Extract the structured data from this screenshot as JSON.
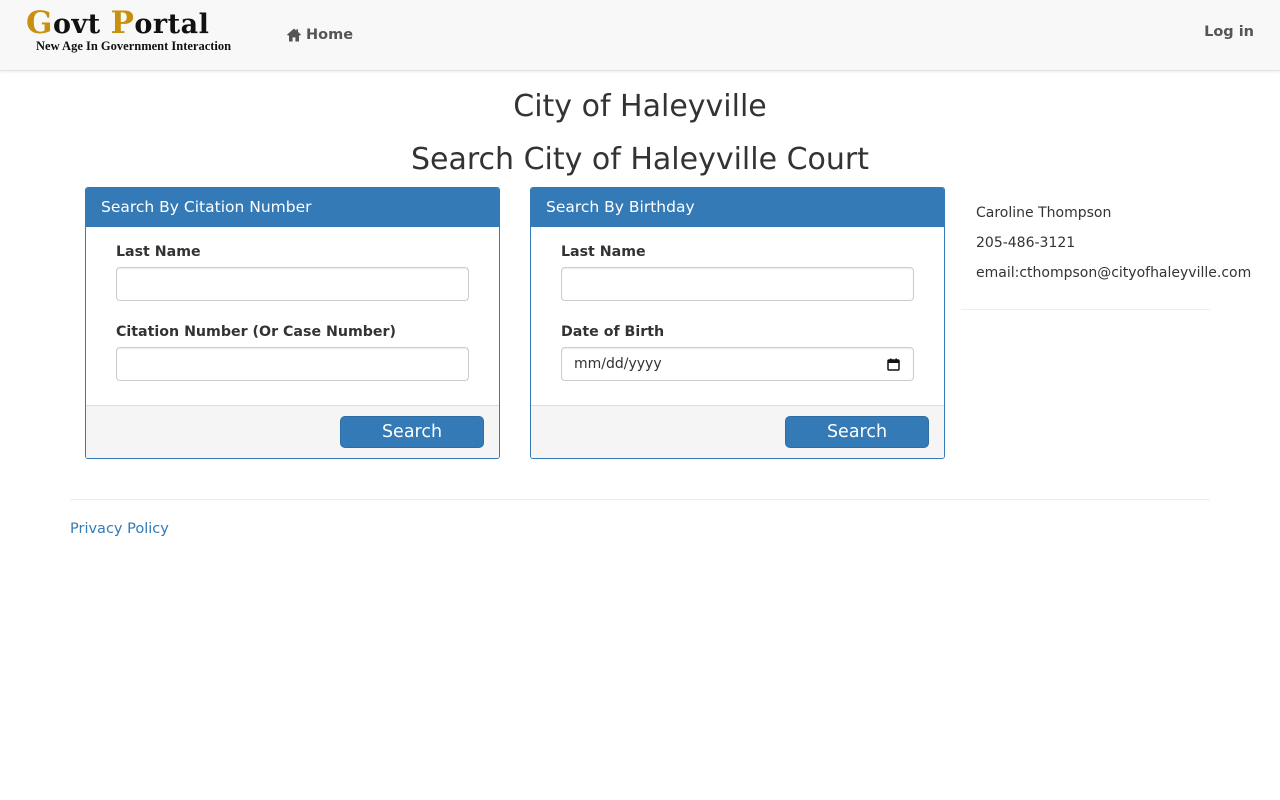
{
  "brand": {
    "title_first_letter": "G",
    "title_first_rest": "ovt ",
    "title_second_letter": "P",
    "title_second_rest": "ortal",
    "tagline": "New Age In Government Interaction"
  },
  "nav": {
    "home_label": "Home",
    "home_icon": "home-icon",
    "login_label": "Log in"
  },
  "page": {
    "title": "City of Haleyville",
    "subtitle": "Search City of Haleyville Court"
  },
  "citation_panel": {
    "heading": "Search By Citation Number",
    "last_name_label": "Last Name",
    "last_name_value": "",
    "citation_label": "Citation Number (Or Case Number)",
    "citation_value": "",
    "search_label": "Search"
  },
  "birthday_panel": {
    "heading": "Search By Birthday",
    "last_name_label": "Last Name",
    "last_name_value": "",
    "dob_label": "Date of Birth",
    "dob_placeholder": "mm/dd/yyyy",
    "dob_icon": "calendar-icon",
    "search_label": "Search"
  },
  "contact": {
    "name": "Caroline Thompson",
    "phone": "205-486-3121",
    "email": "email:cthompson@cityofhaleyville.com"
  },
  "footer": {
    "privacy_label": "Privacy Policy"
  },
  "colors": {
    "primary": "#337ab7",
    "brand_accent": "#c8900e",
    "navbar_bg": "#f8f8f8",
    "panel_footer_bg": "#f5f5f5"
  }
}
